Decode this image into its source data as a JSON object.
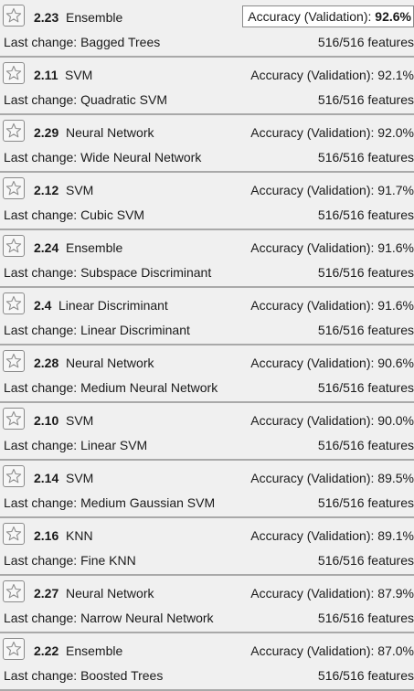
{
  "best_model_index": 0,
  "models": [
    {
      "number": "2.23",
      "type": "Ensemble",
      "accuracy_label": "Accuracy (Validation):",
      "accuracy_value": "92.6%",
      "last_change_label": "Last change:",
      "last_change_value": "Bagged Trees",
      "features": "516/516 features"
    },
    {
      "number": "2.11",
      "type": "SVM",
      "accuracy_label": "Accuracy (Validation):",
      "accuracy_value": "92.1%",
      "last_change_label": "Last change:",
      "last_change_value": "Quadratic SVM",
      "features": "516/516 features"
    },
    {
      "number": "2.29",
      "type": "Neural Network",
      "accuracy_label": "Accuracy (Validation):",
      "accuracy_value": "92.0%",
      "last_change_label": "Last change:",
      "last_change_value": "Wide Neural Network",
      "features": "516/516 features"
    },
    {
      "number": "2.12",
      "type": "SVM",
      "accuracy_label": "Accuracy (Validation):",
      "accuracy_value": "91.7%",
      "last_change_label": "Last change:",
      "last_change_value": "Cubic SVM",
      "features": "516/516 features"
    },
    {
      "number": "2.24",
      "type": "Ensemble",
      "accuracy_label": "Accuracy (Validation):",
      "accuracy_value": "91.6%",
      "last_change_label": "Last change:",
      "last_change_value": "Subspace Discriminant",
      "features": "516/516 features"
    },
    {
      "number": "2.4",
      "type": "Linear Discriminant",
      "accuracy_label": "Accuracy (Validation):",
      "accuracy_value": "91.6%",
      "last_change_label": "Last change:",
      "last_change_value": "Linear Discriminant",
      "features": "516/516 features"
    },
    {
      "number": "2.28",
      "type": "Neural Network",
      "accuracy_label": "Accuracy (Validation):",
      "accuracy_value": "90.6%",
      "last_change_label": "Last change:",
      "last_change_value": "Medium Neural Network",
      "features": "516/516 features"
    },
    {
      "number": "2.10",
      "type": "SVM",
      "accuracy_label": "Accuracy (Validation):",
      "accuracy_value": "90.0%",
      "last_change_label": "Last change:",
      "last_change_value": "Linear SVM",
      "features": "516/516 features"
    },
    {
      "number": "2.14",
      "type": "SVM",
      "accuracy_label": "Accuracy (Validation):",
      "accuracy_value": "89.5%",
      "last_change_label": "Last change:",
      "last_change_value": "Medium Gaussian SVM",
      "features": "516/516 features"
    },
    {
      "number": "2.16",
      "type": "KNN",
      "accuracy_label": "Accuracy (Validation):",
      "accuracy_value": "89.1%",
      "last_change_label": "Last change:",
      "last_change_value": "Fine KNN",
      "features": "516/516 features"
    },
    {
      "number": "2.27",
      "type": "Neural Network",
      "accuracy_label": "Accuracy (Validation):",
      "accuracy_value": "87.9%",
      "last_change_label": "Last change:",
      "last_change_value": "Narrow Neural Network",
      "features": "516/516 features"
    },
    {
      "number": "2.22",
      "type": "Ensemble",
      "accuracy_label": "Accuracy (Validation):",
      "accuracy_value": "87.0%",
      "last_change_label": "Last change:",
      "last_change_value": "Boosted Trees",
      "features": "516/516 features"
    }
  ]
}
